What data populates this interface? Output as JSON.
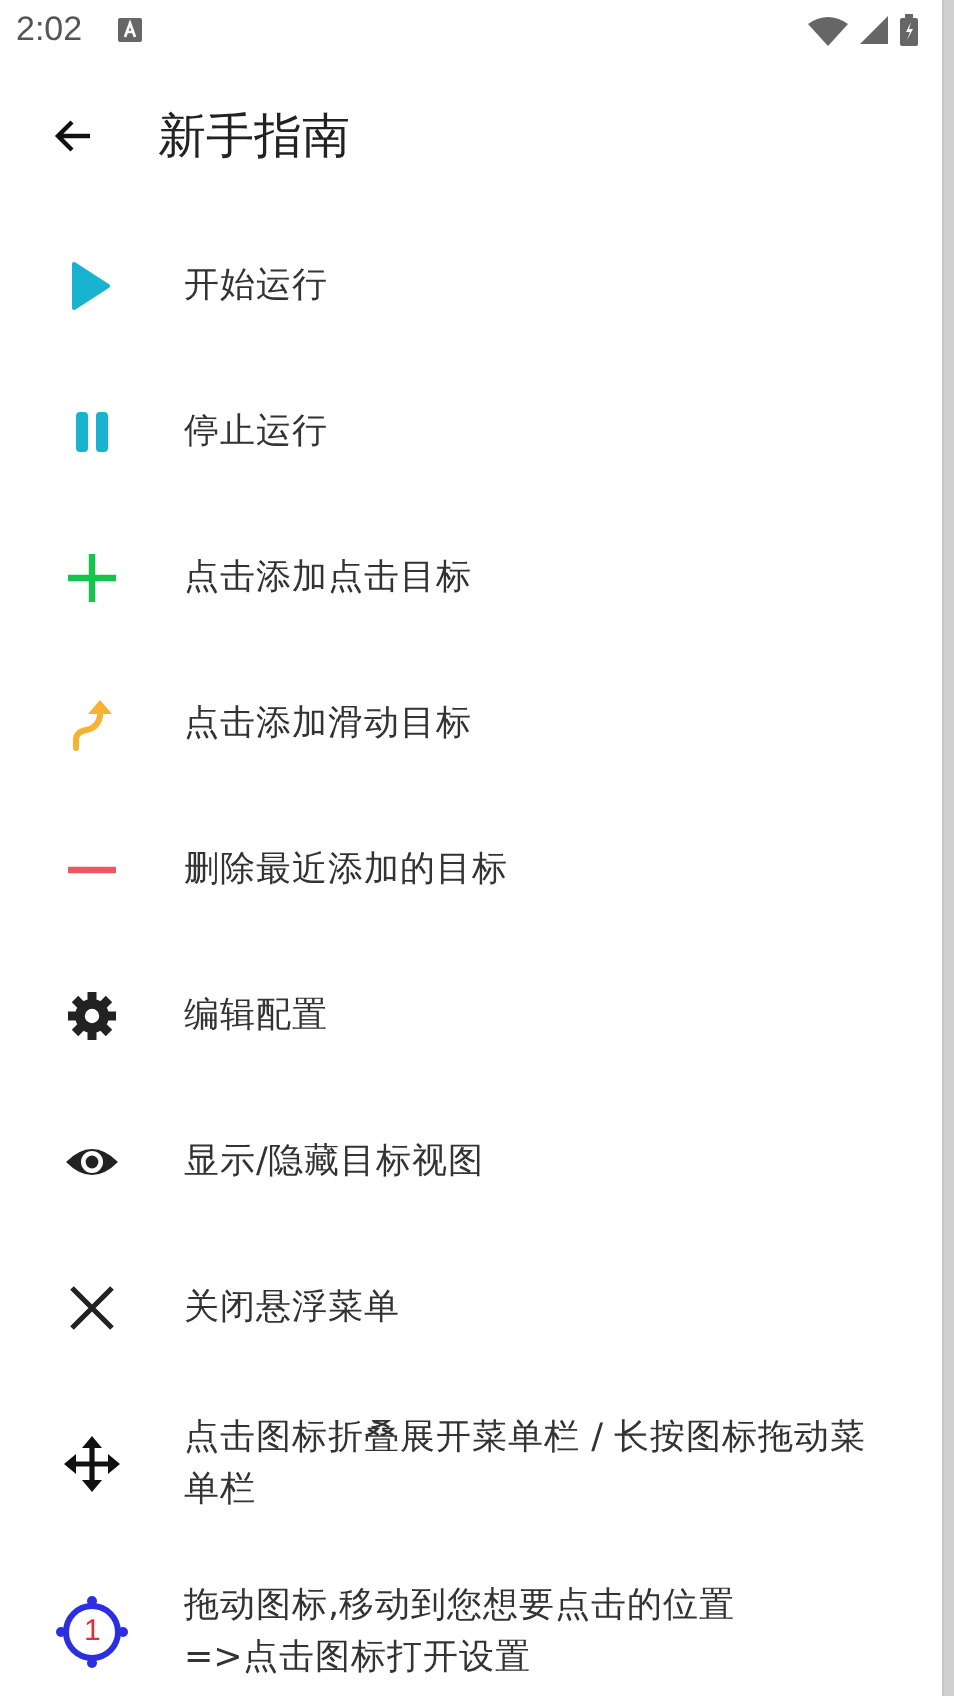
{
  "status_bar": {
    "time": "2:02"
  },
  "toolbar": {
    "title": "新手指南"
  },
  "items": [
    {
      "kind": "play",
      "label": "开始运行"
    },
    {
      "kind": "pause",
      "label": "停止运行"
    },
    {
      "kind": "add",
      "label": "点击添加点击目标"
    },
    {
      "kind": "swipe",
      "label": "点击添加滑动目标"
    },
    {
      "kind": "remove",
      "label": "删除最近添加的目标"
    },
    {
      "kind": "settings",
      "label": "编辑配置"
    },
    {
      "kind": "eye",
      "label": "显示/隐藏目标视图"
    },
    {
      "kind": "close",
      "label": "关闭悬浮菜单"
    },
    {
      "kind": "move",
      "label": "点击图标折叠展开菜单栏 / 长按图标拖动菜单栏"
    },
    {
      "kind": "target",
      "label": "拖动图标,移动到您想要点击的位置\n=>点击图标打开设置",
      "badge": "1"
    }
  ]
}
